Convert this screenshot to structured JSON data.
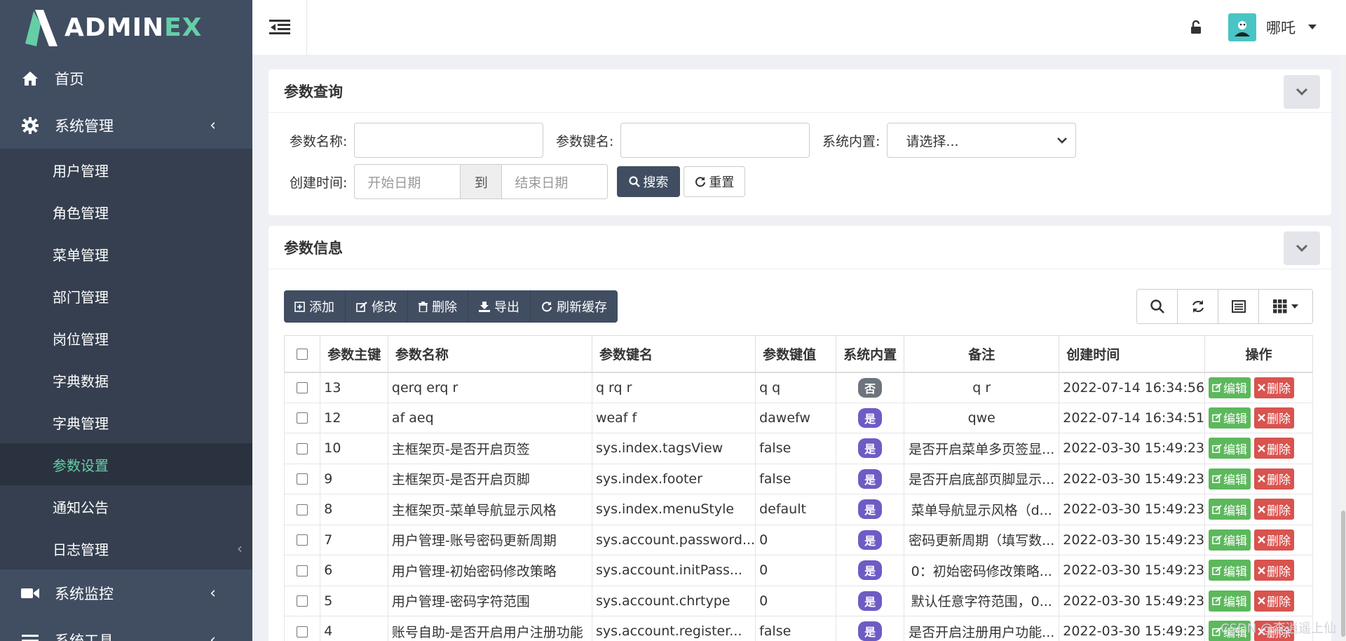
{
  "brand": {
    "logo_main": "ADMIN",
    "logo_accent": "EX"
  },
  "sidebar": {
    "home": "首页",
    "system": "系统管理",
    "sub_items": [
      "用户管理",
      "角色管理",
      "菜单管理",
      "部门管理",
      "岗位管理",
      "字典数据",
      "字典管理",
      "参数设置",
      "通知公告",
      "日志管理"
    ],
    "active_index": 7,
    "monitor": "系统监控",
    "tools": "系统工具"
  },
  "header": {
    "user_name": "哪吒"
  },
  "query_panel": {
    "title": "参数查询",
    "param_name_label": "参数名称:",
    "param_key_label": "参数键名:",
    "builtin_label": "系统内置:",
    "builtin_selected": "请选择...",
    "create_time_label": "创建时间:",
    "start_placeholder": "开始日期",
    "to_label": "到",
    "end_placeholder": "结束日期",
    "search_btn": "搜索",
    "reset_btn": "重置"
  },
  "info_panel": {
    "title": "参数信息",
    "toolbar": {
      "add": "添加",
      "edit": "修改",
      "delete": "删除",
      "export": "导出",
      "refresh_cache": "刷新缓存"
    }
  },
  "table": {
    "headers": [
      "参数主键",
      "参数名称",
      "参数键名",
      "参数键值",
      "系统内置",
      "备注",
      "创建时间",
      "操作"
    ],
    "edit_label": "编辑",
    "delete_label": "删除",
    "rows": [
      {
        "id": "13",
        "name": "qerq erq r",
        "key": "q rq r",
        "value": "q q",
        "builtin": "否",
        "remark": "q r",
        "time": "2022-07-14 16:34:56"
      },
      {
        "id": "12",
        "name": "af aeq",
        "key": "weaf f",
        "value": "dawefw",
        "builtin": "是",
        "remark": "qwe",
        "time": "2022-07-14 16:34:51"
      },
      {
        "id": "10",
        "name": "主框架页-是否开启页签",
        "key": "sys.index.tagsView",
        "value": "false",
        "builtin": "是",
        "remark": "是否开启菜单多页签显...",
        "time": "2022-03-30 15:49:23"
      },
      {
        "id": "9",
        "name": "主框架页-是否开启页脚",
        "key": "sys.index.footer",
        "value": "false",
        "builtin": "是",
        "remark": "是否开启底部页脚显示...",
        "time": "2022-03-30 15:49:23"
      },
      {
        "id": "8",
        "name": "主框架页-菜单导航显示风格",
        "key": "sys.index.menuStyle",
        "value": "default",
        "builtin": "是",
        "remark": "菜单导航显示风格（d...",
        "time": "2022-03-30 15:49:23"
      },
      {
        "id": "7",
        "name": "用户管理-账号密码更新周期",
        "key": "sys.account.password...",
        "value": "0",
        "builtin": "是",
        "remark": "密码更新周期（填写数...",
        "time": "2022-03-30 15:49:23"
      },
      {
        "id": "6",
        "name": "用户管理-初始密码修改策略",
        "key": "sys.account.initPass...",
        "value": "0",
        "builtin": "是",
        "remark": "0：初始密码修改策略...",
        "time": "2022-03-30 15:49:23"
      },
      {
        "id": "5",
        "name": "用户管理-密码字符范围",
        "key": "sys.account.chrtype",
        "value": "0",
        "builtin": "是",
        "remark": "默认任意字符范围，0...",
        "time": "2022-03-30 15:49:23"
      },
      {
        "id": "4",
        "name": "账号自助-是否开启用户注册功能",
        "key": "sys.account.register...",
        "value": "false",
        "builtin": "是",
        "remark": "是否开启注册用户功能...",
        "time": "2022-03-30 15:49:23"
      }
    ]
  },
  "watermark": "CSDN @李逍遥上仙"
}
